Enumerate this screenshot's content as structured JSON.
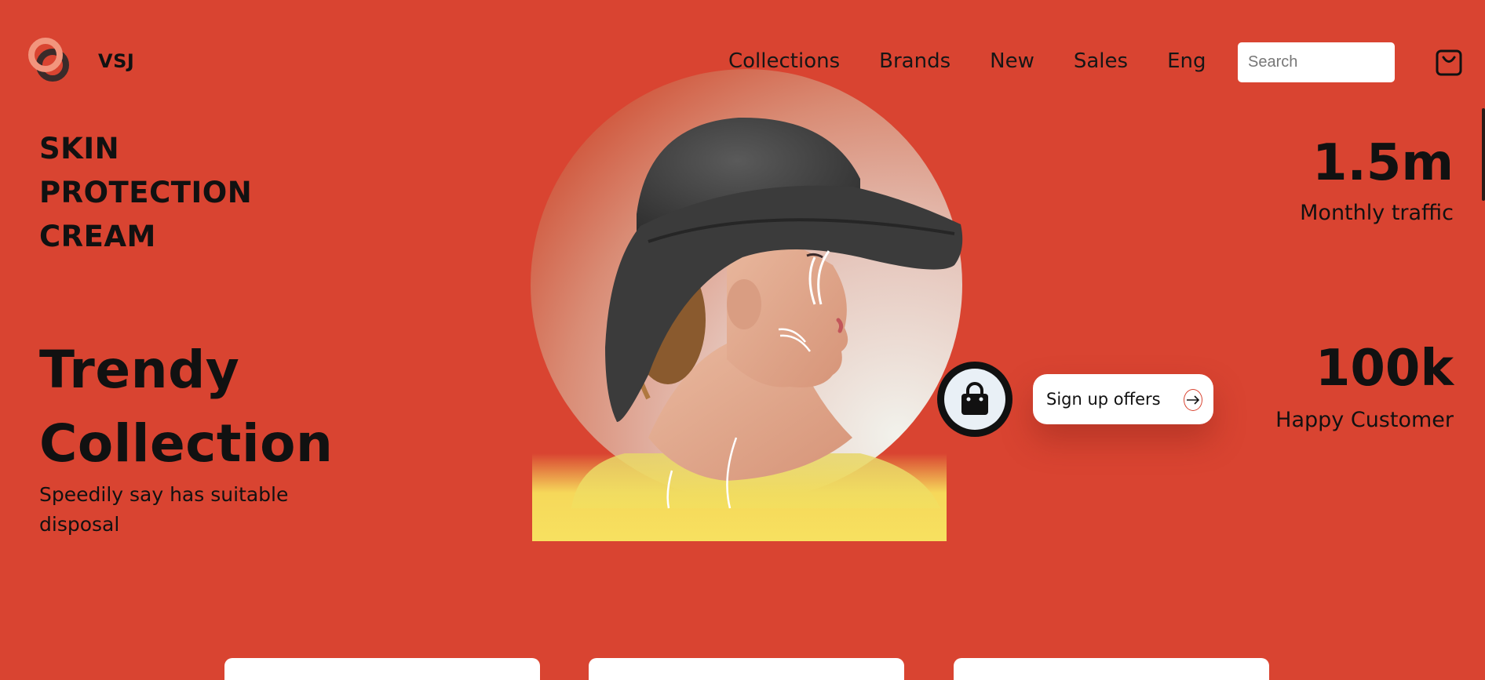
{
  "brand": {
    "name": "VSJ",
    "logo_icon": "two-rings-logo"
  },
  "nav": {
    "items": [
      {
        "label": "Collections"
      },
      {
        "label": "Brands"
      },
      {
        "label": "New"
      },
      {
        "label": "Sales"
      },
      {
        "label": "Eng"
      }
    ],
    "search_placeholder": "Search",
    "cart_icon": "cart-icon"
  },
  "hero": {
    "product_lines": [
      "SKIN",
      "PROTECTION",
      "CREAM"
    ],
    "headline_lines": [
      "Trendy",
      "Collection"
    ],
    "tagline": "Speedily say has suitable disposal",
    "image": "woman-in-black-hat-portrait"
  },
  "cta": {
    "bag_icon": "shopping-bag-icon",
    "signup_label": "Sign up offers",
    "arrow_icon": "arrow-right-icon"
  },
  "stats": [
    {
      "value": "1.5m",
      "label": "Monthly traffic"
    },
    {
      "value": "100k",
      "label": "Happy Customer"
    }
  ],
  "colors": {
    "background": "#d94431",
    "logo_light": "#f2957d",
    "logo_dark": "#3b2b2a",
    "accent_yellow": "#f6d85a"
  }
}
